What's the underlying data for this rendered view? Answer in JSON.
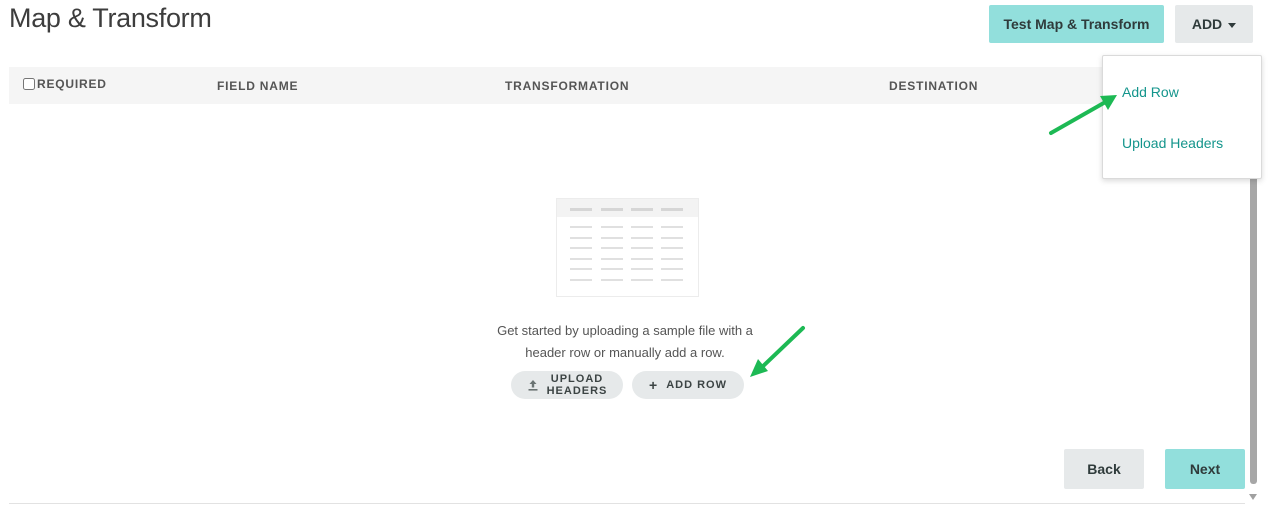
{
  "page": {
    "title": "Map & Transform"
  },
  "header": {
    "test_button": "Test Map & Transform",
    "add_button": "ADD"
  },
  "table": {
    "columns": [
      "REQUIRED",
      "FIELD NAME",
      "TRANSFORMATION",
      "DESTINATION"
    ]
  },
  "empty_state": {
    "message_line1": "Get started by uploading a sample file with a",
    "message_line2": "header row or manually add a row.",
    "upload_headers_line1": "UPLOAD",
    "upload_headers_line2": "HEADERS",
    "add_row": "ADD ROW"
  },
  "footer": {
    "back_button": "Back",
    "next_button": "Next"
  },
  "dropdown": {
    "items": [
      "Add Row",
      "Upload Headers"
    ]
  },
  "colors": {
    "accent": "#92dfdc",
    "link": "#14958c",
    "annotation_arrow": "#1db954"
  },
  "icons": {
    "add_caret": "chevron-down-icon",
    "upload": "upload-icon",
    "add": "plus-icon"
  }
}
